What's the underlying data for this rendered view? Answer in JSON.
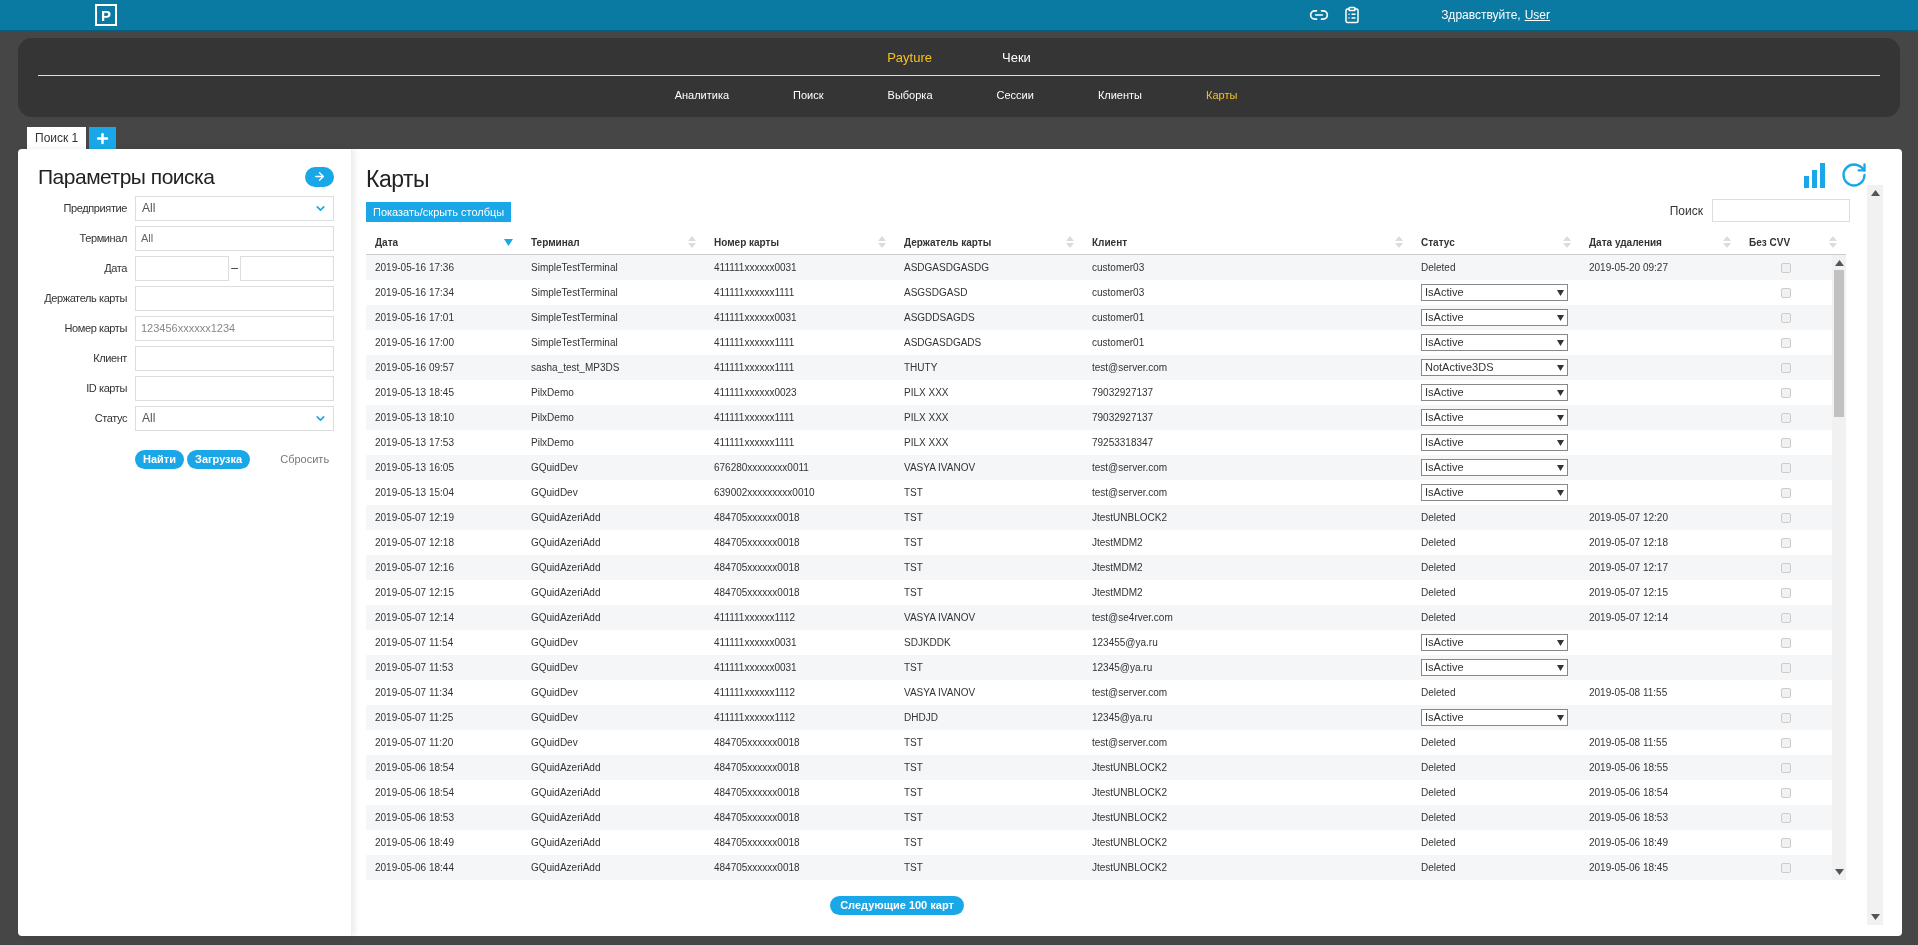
{
  "topbar": {
    "logo": "P",
    "greeting": "Здравствуйте,",
    "user": "User"
  },
  "nav": {
    "top": [
      {
        "label": "Payture",
        "selected": true
      },
      {
        "label": "Чеки",
        "selected": false
      }
    ],
    "sub": [
      {
        "label": "Аналитика",
        "selected": false
      },
      {
        "label": "Поиск",
        "selected": false
      },
      {
        "label": "Выборка",
        "selected": false
      },
      {
        "label": "Сессии",
        "selected": false
      },
      {
        "label": "Клиенты",
        "selected": false
      },
      {
        "label": "Карты",
        "selected": true
      }
    ]
  },
  "tabs": [
    {
      "label": "Поиск 1",
      "selected": true
    }
  ],
  "search_panel": {
    "title": "Параметры поиска",
    "fields": [
      {
        "label": "Предприятие",
        "kind": "select",
        "value": "All"
      },
      {
        "label": "Терминал",
        "kind": "text",
        "value": "All"
      },
      {
        "label": "Дата",
        "kind": "range",
        "separator": "–"
      },
      {
        "label": "Держатель карты",
        "kind": "text"
      },
      {
        "label": "Номер карты",
        "kind": "text",
        "placeholder": "123456xxxxxx1234"
      },
      {
        "label": "Клиент",
        "kind": "text"
      },
      {
        "label": "ID карты",
        "kind": "text"
      },
      {
        "label": "Статус",
        "kind": "select",
        "value": "All"
      }
    ],
    "buttons": [
      "Найти",
      "Загрузка"
    ],
    "reset": "Сбросить"
  },
  "cards": {
    "title": "Карты",
    "columns_button": "Показать/скрыть столбцы",
    "search_label": "Поиск",
    "columns": [
      {
        "label": "Дата",
        "sorted": true
      },
      {
        "label": "Терминал",
        "sorted": false
      },
      {
        "label": "Номер карты",
        "sorted": false
      },
      {
        "label": "Держатель карты",
        "sorted": false
      },
      {
        "label": "Клиент",
        "sorted": false
      },
      {
        "label": "Статус",
        "sorted": false
      },
      {
        "label": "Дата удаления",
        "sorted": false
      },
      {
        "label": "Без CVV",
        "sorted": false
      }
    ],
    "rows": [
      {
        "date": "2019-05-16 17:36",
        "terminal": "SimpleTestTerminal",
        "card": "411111xxxxxx0031",
        "holder": "ASDGASDGASDG",
        "client": "customer03",
        "status": {
          "kind": "text",
          "value": "Deleted"
        },
        "deleted": "2019-05-20 09:27",
        "no_cvv": {
          "checked": false
        }
      },
      {
        "date": "2019-05-16 17:34",
        "terminal": "SimpleTestTerminal",
        "card": "411111xxxxxx1111",
        "holder": "ASGSDGASD",
        "client": "customer03",
        "status": {
          "kind": "select",
          "value": "IsActive"
        },
        "no_cvv": {
          "checked": false
        }
      },
      {
        "date": "2019-05-16 17:01",
        "terminal": "SimpleTestTerminal",
        "card": "411111xxxxxx0031",
        "holder": "ASGDDSAGDS",
        "client": "customer01",
        "status": {
          "kind": "select",
          "value": "IsActive"
        },
        "no_cvv": {
          "checked": false
        }
      },
      {
        "date": "2019-05-16 17:00",
        "terminal": "SimpleTestTerminal",
        "card": "411111xxxxxx1111",
        "holder": "ASDGASDGADS",
        "client": "customer01",
        "status": {
          "kind": "select",
          "value": "IsActive"
        },
        "no_cvv": {
          "checked": false
        }
      },
      {
        "date": "2019-05-16 09:57",
        "terminal": "sasha_test_MP3DS",
        "card": "411111xxxxxx1111",
        "holder": "THUTY",
        "client": "test@server.com",
        "status": {
          "kind": "select",
          "value": "NotActive3DS"
        },
        "no_cvv": {
          "checked": false
        }
      },
      {
        "date": "2019-05-13 18:45",
        "terminal": "PilxDemo",
        "card": "411111xxxxxx0023",
        "holder": "PILX XXX",
        "client": "79032927137",
        "status": {
          "kind": "select",
          "value": "IsActive"
        },
        "no_cvv": {
          "checked": false
        }
      },
      {
        "date": "2019-05-13 18:10",
        "terminal": "PilxDemo",
        "card": "411111xxxxxx1111",
        "holder": "PILX XXX",
        "client": "79032927137",
        "status": {
          "kind": "select",
          "value": "IsActive"
        },
        "no_cvv": {
          "checked": false
        }
      },
      {
        "date": "2019-05-13 17:53",
        "terminal": "PilxDemo",
        "card": "411111xxxxxx1111",
        "holder": "PILX XXX",
        "client": "79253318347",
        "status": {
          "kind": "select",
          "value": "IsActive"
        },
        "no_cvv": {
          "checked": false
        }
      },
      {
        "date": "2019-05-13 16:05",
        "terminal": "GQuidDev",
        "card": "676280xxxxxxxx0011",
        "holder": "VASYA IVANOV",
        "client": "test@server.com",
        "status": {
          "kind": "select",
          "value": "IsActive"
        },
        "no_cvv": {
          "checked": false
        }
      },
      {
        "date": "2019-05-13 15:04",
        "terminal": "GQuidDev",
        "card": "639002xxxxxxxxx0010",
        "holder": "TST",
        "client": "test@server.com",
        "status": {
          "kind": "select",
          "value": "IsActive"
        },
        "no_cvv": {
          "checked": false
        }
      },
      {
        "date": "2019-05-07 12:19",
        "terminal": "GQuidAzeriAdd",
        "card": "484705xxxxxx0018",
        "holder": "TST",
        "client": "JtestUNBLOCK2",
        "status": {
          "kind": "text",
          "value": "Deleted"
        },
        "deleted": "2019-05-07 12:20",
        "no_cvv": {
          "checked": false
        }
      },
      {
        "date": "2019-05-07 12:18",
        "terminal": "GQuidAzeriAdd",
        "card": "484705xxxxxx0018",
        "holder": "TST",
        "client": "JtestMDM2",
        "status": {
          "kind": "text",
          "value": "Deleted"
        },
        "deleted": "2019-05-07 12:18",
        "no_cvv": {
          "checked": false
        }
      },
      {
        "date": "2019-05-07 12:16",
        "terminal": "GQuidAzeriAdd",
        "card": "484705xxxxxx0018",
        "holder": "TST",
        "client": "JtestMDM2",
        "status": {
          "kind": "text",
          "value": "Deleted"
        },
        "deleted": "2019-05-07 12:17",
        "no_cvv": {
          "checked": false
        }
      },
      {
        "date": "2019-05-07 12:15",
        "terminal": "GQuidAzeriAdd",
        "card": "484705xxxxxx0018",
        "holder": "TST",
        "client": "JtestMDM2",
        "status": {
          "kind": "text",
          "value": "Deleted"
        },
        "deleted": "2019-05-07 12:15",
        "no_cvv": {
          "checked": false
        }
      },
      {
        "date": "2019-05-07 12:14",
        "terminal": "GQuidAzeriAdd",
        "card": "411111xxxxxx1112",
        "holder": "VASYA IVANOV",
        "client": "test@se4rver.com",
        "status": {
          "kind": "text",
          "value": "Deleted"
        },
        "deleted": "2019-05-07 12:14",
        "no_cvv": {
          "checked": false
        }
      },
      {
        "date": "2019-05-07 11:54",
        "terminal": "GQuidDev",
        "card": "411111xxxxxx0031",
        "holder": "SDJKDDK",
        "client": "123455@ya.ru",
        "status": {
          "kind": "select",
          "value": "IsActive"
        },
        "no_cvv": {
          "checked": false
        }
      },
      {
        "date": "2019-05-07 11:53",
        "terminal": "GQuidDev",
        "card": "411111xxxxxx0031",
        "holder": "TST",
        "client": "12345@ya.ru",
        "status": {
          "kind": "select",
          "value": "IsActive"
        },
        "no_cvv": {
          "checked": false
        }
      },
      {
        "date": "2019-05-07 11:34",
        "terminal": "GQuidDev",
        "card": "411111xxxxxx1112",
        "holder": "VASYA IVANOV",
        "client": "test@server.com",
        "status": {
          "kind": "text",
          "value": "Deleted"
        },
        "deleted": "2019-05-08 11:55",
        "no_cvv": {
          "checked": false
        }
      },
      {
        "date": "2019-05-07 11:25",
        "terminal": "GQuidDev",
        "card": "411111xxxxxx1112",
        "holder": "DHDJD",
        "client": "12345@ya.ru",
        "status": {
          "kind": "select",
          "value": "IsActive"
        },
        "no_cvv": {
          "checked": false
        }
      },
      {
        "date": "2019-05-07 11:20",
        "terminal": "GQuidDev",
        "card": "484705xxxxxx0018",
        "holder": "TST",
        "client": "test@server.com",
        "status": {
          "kind": "text",
          "value": "Deleted"
        },
        "deleted": "2019-05-08 11:55",
        "no_cvv": {
          "checked": false
        }
      },
      {
        "date": "2019-05-06 18:54",
        "terminal": "GQuidAzeriAdd",
        "card": "484705xxxxxx0018",
        "holder": "TST",
        "client": "JtestUNBLOCK2",
        "status": {
          "kind": "text",
          "value": "Deleted"
        },
        "deleted": "2019-05-06 18:55",
        "no_cvv": {
          "checked": false
        }
      },
      {
        "date": "2019-05-06 18:54",
        "terminal": "GQuidAzeriAdd",
        "card": "484705xxxxxx0018",
        "holder": "TST",
        "client": "JtestUNBLOCK2",
        "status": {
          "kind": "text",
          "value": "Deleted"
        },
        "deleted": "2019-05-06 18:54",
        "no_cvv": {
          "checked": false
        }
      },
      {
        "date": "2019-05-06 18:53",
        "terminal": "GQuidAzeriAdd",
        "card": "484705xxxxxx0018",
        "holder": "TST",
        "client": "JtestUNBLOCK2",
        "status": {
          "kind": "text",
          "value": "Deleted"
        },
        "deleted": "2019-05-06 18:53",
        "no_cvv": {
          "checked": false
        }
      },
      {
        "date": "2019-05-06 18:49",
        "terminal": "GQuidAzeriAdd",
        "card": "484705xxxxxx0018",
        "holder": "TST",
        "client": "JtestUNBLOCK2",
        "status": {
          "kind": "text",
          "value": "Deleted"
        },
        "deleted": "2019-05-06 18:49",
        "no_cvv": {
          "checked": false
        }
      },
      {
        "date": "2019-05-06 18:44",
        "terminal": "GQuidAzeriAdd",
        "card": "484705xxxxxx0018",
        "holder": "TST",
        "client": "JtestUNBLOCK2",
        "status": {
          "kind": "text",
          "value": "Deleted"
        },
        "deleted": "2019-05-06 18:45",
        "no_cvv": {
          "checked": false
        }
      }
    ],
    "next_button": "Следующие 100 карт"
  }
}
